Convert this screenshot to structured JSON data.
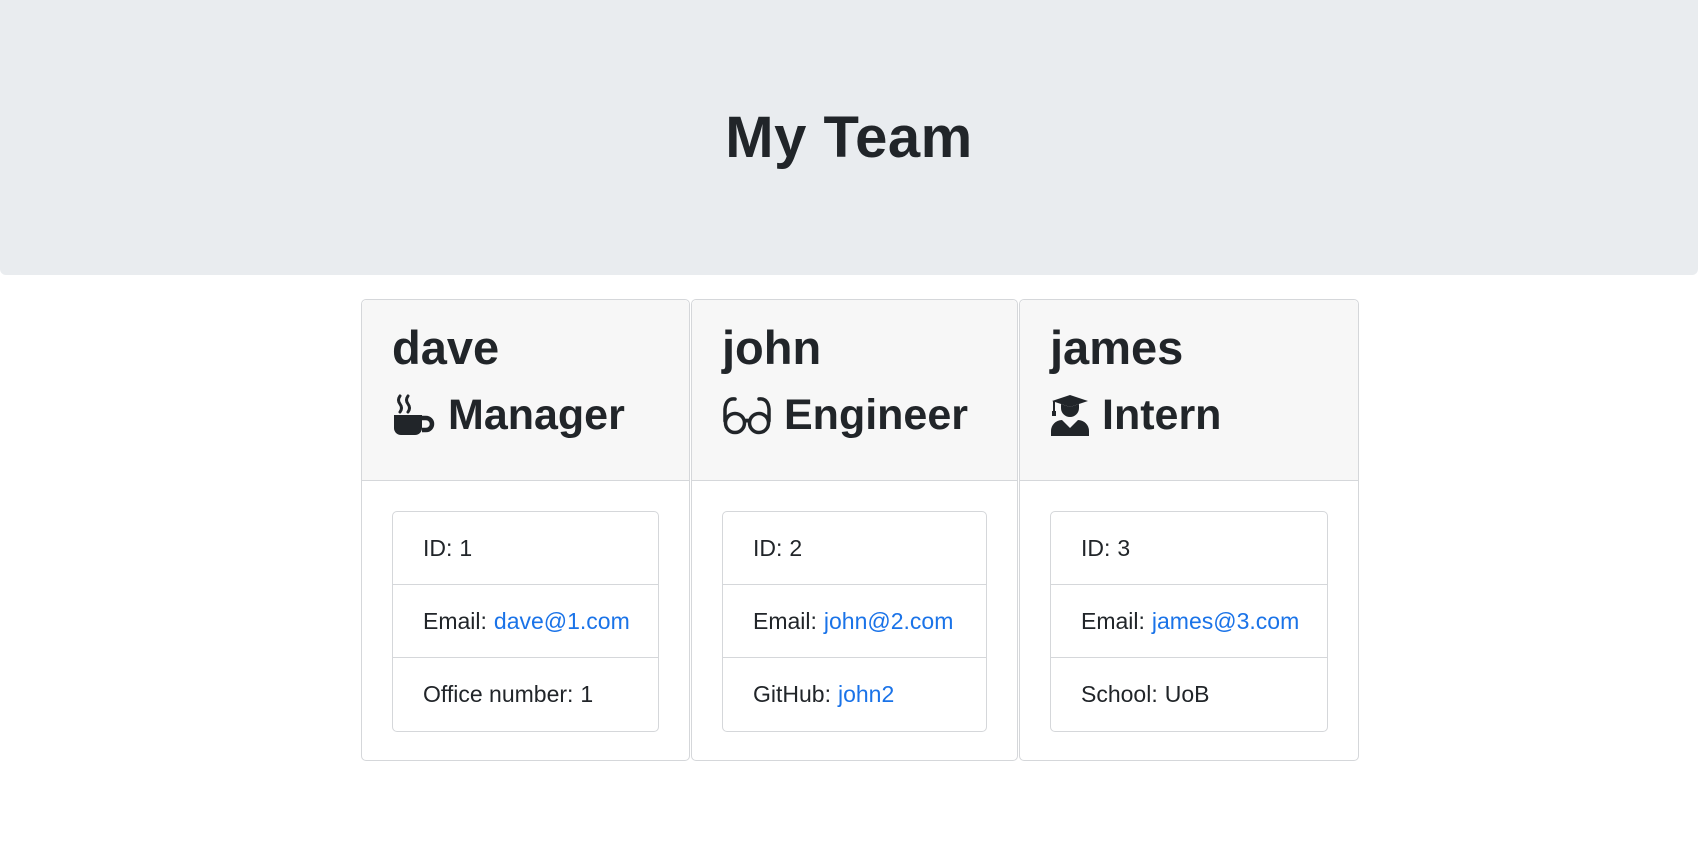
{
  "header": {
    "title": "My Team"
  },
  "team": [
    {
      "name": "dave",
      "role": "Manager",
      "role_icon": "mug-icon",
      "id_label": "ID:",
      "id": "1",
      "email_label": "Email:",
      "email": "dave@1.com",
      "extra_label": "Office number:",
      "extra_value": "1"
    },
    {
      "name": "john",
      "role": "Engineer",
      "role_icon": "glasses-icon",
      "id_label": "ID:",
      "id": "2",
      "email_label": "Email:",
      "email": "john@2.com",
      "extra_label": "GitHub:",
      "extra_value": "john2"
    },
    {
      "name": "james",
      "role": "Intern",
      "role_icon": "graduate-icon",
      "id_label": "ID:",
      "id": "3",
      "email_label": "Email:",
      "email": "james@3.com",
      "extra_label": "School:",
      "extra_value": "UoB"
    }
  ],
  "colors": {
    "jumbotron_bg": "#e9ecef",
    "header_bg": "#f7f7f7",
    "link": "#1a73e8",
    "text": "#212529"
  }
}
